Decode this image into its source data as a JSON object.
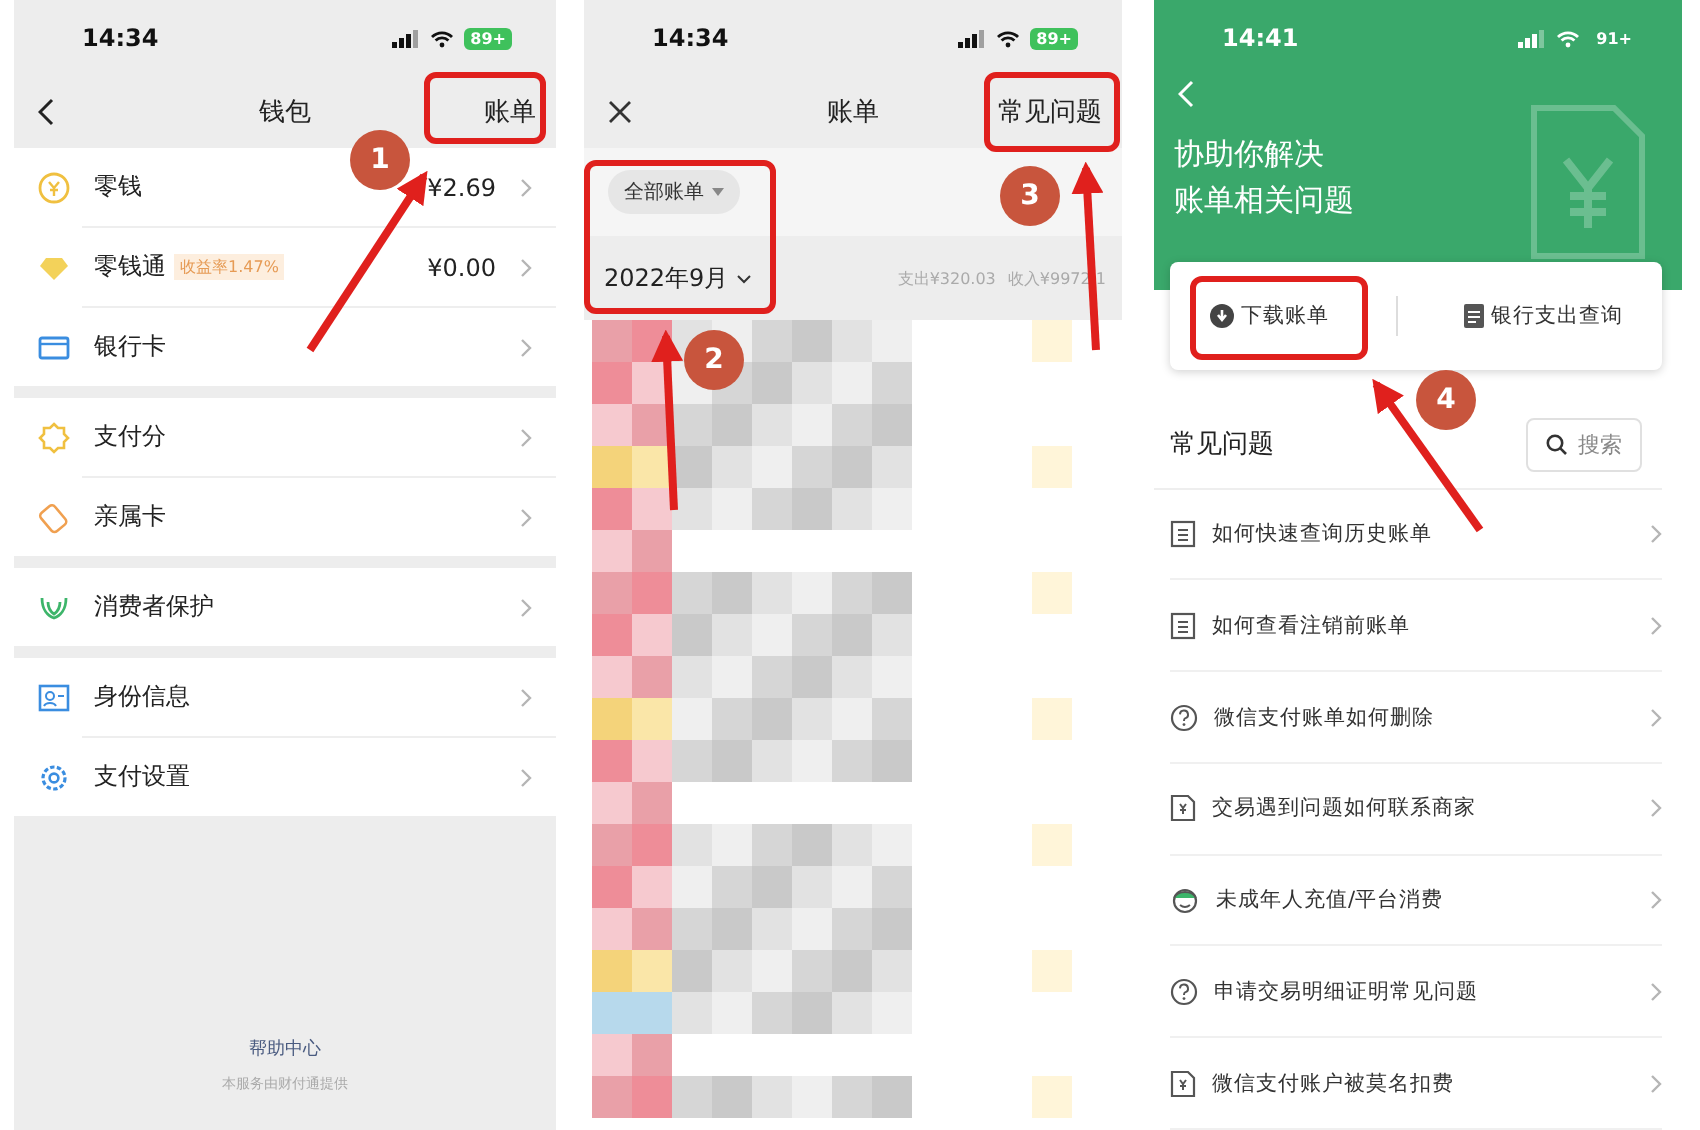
{
  "wallet": {
    "status": {
      "time": "14:34",
      "battery": "89+"
    },
    "title": "钱包",
    "action": "账单",
    "sections": [
      [
        {
          "kind": "coin",
          "label": "零钱",
          "value": "¥2.69"
        },
        {
          "kind": "diamond",
          "label": "零钱通",
          "tag": "收益率1.47%",
          "value": "¥0.00"
        },
        {
          "kind": "card",
          "label": "银行卡"
        }
      ],
      [
        {
          "kind": "score",
          "label": "支付分"
        },
        {
          "kind": "family",
          "label": "亲属卡"
        }
      ],
      [
        {
          "kind": "shield",
          "label": "消费者保护"
        }
      ],
      [
        {
          "kind": "id",
          "label": "身份信息"
        },
        {
          "kind": "gear",
          "label": "支付设置"
        }
      ]
    ],
    "help_link": "帮助中心",
    "provider_note": "本服务由财付通提供"
  },
  "bills": {
    "status": {
      "time": "14:34",
      "battery": "89+"
    },
    "title": "账单",
    "action": "常见问题",
    "filter": "全部账单",
    "month": "2022年9月",
    "expense": "支出¥320.03",
    "income": "收入¥9972.1"
  },
  "help": {
    "status": {
      "time": "14:41",
      "battery": "91+"
    },
    "heading": [
      "协助你解决",
      "账单相关问题"
    ],
    "buttons": [
      {
        "kind": "download",
        "label": "下载账单"
      },
      {
        "kind": "doc",
        "label": "银行支出查询"
      }
    ],
    "section_title": "常见问题",
    "search": "搜索",
    "questions": [
      {
        "kind": "doc",
        "text": "如何快速查询历史账单"
      },
      {
        "kind": "doc",
        "text": "如何查看注销前账单"
      },
      {
        "kind": "question",
        "text": "微信支付账单如何删除"
      },
      {
        "kind": "receipt",
        "text": "交易遇到问题如何联系商家"
      },
      {
        "kind": "child",
        "text": "未成年人充值/平台消费"
      },
      {
        "kind": "question",
        "text": "申请交易明细证明常见问题"
      },
      {
        "kind": "receipt",
        "text": "微信支付账户被莫名扣费"
      }
    ]
  },
  "annotations": [
    {
      "number": "1"
    },
    {
      "number": "2"
    },
    {
      "number": "3"
    },
    {
      "number": "4"
    }
  ]
}
